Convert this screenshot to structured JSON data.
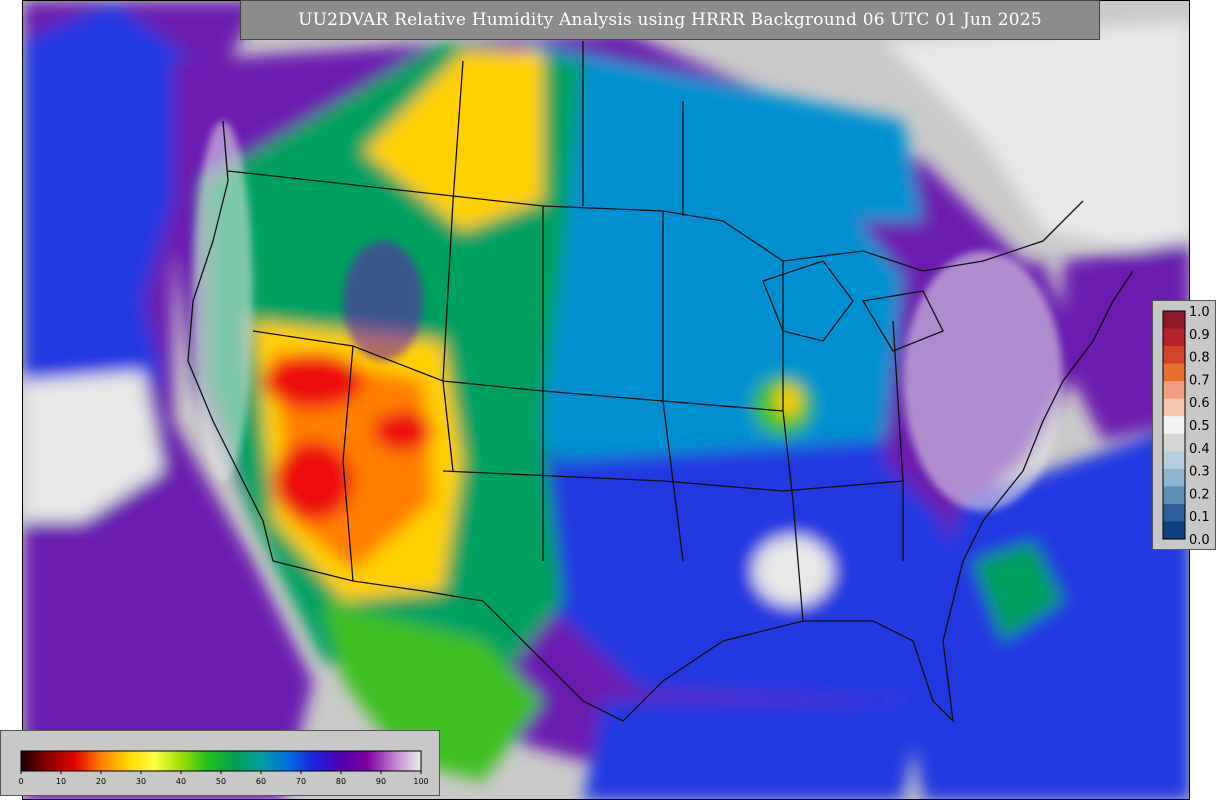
{
  "title": "UU2DVAR Relative Humidity Analysis using HRRR Background 06 UTC 01 Jun 2025",
  "colorbar_vertical": {
    "labels": [
      "1.0",
      "0.9",
      "0.8",
      "0.7",
      "0.6",
      "0.5",
      "0.4",
      "0.3",
      "0.2",
      "0.1",
      "0.0"
    ],
    "colors": [
      "#8c1a2b",
      "#b3222f",
      "#d2452a",
      "#e6712f",
      "#f0a080",
      "#f6c6b0",
      "#f2f2f2",
      "#d6d6d6",
      "#b9cde0",
      "#8eb4cf",
      "#5e8fb8",
      "#2e5f9a",
      "#0f3f80"
    ]
  },
  "colorbar_horizontal": {
    "labels": [
      "0",
      "10",
      "20",
      "30",
      "40",
      "50",
      "60",
      "70",
      "80",
      "90",
      "100"
    ],
    "colors": [
      "#1a0000",
      "#8b0000",
      "#e00000",
      "#ff7f00",
      "#ffd700",
      "#ffff40",
      "#a0e000",
      "#20c020",
      "#00a050",
      "#00a0a0",
      "#0070e0",
      "#2020e0",
      "#5000b0",
      "#8000a0",
      "#c080d0",
      "#f0f0f0"
    ]
  },
  "map": {
    "colors": {
      "ocean": "#c9c9c9",
      "very_humid": "#6a1fb0",
      "humid": "#2438e0",
      "moist": "#0090d0",
      "moderate": "#00a060",
      "dry": "#40c020",
      "drier": "#ffd000",
      "arid": "#ff7f00",
      "very_arid": "#ee1010",
      "saturated": "#e8e8e8",
      "border": "#111111"
    }
  }
}
